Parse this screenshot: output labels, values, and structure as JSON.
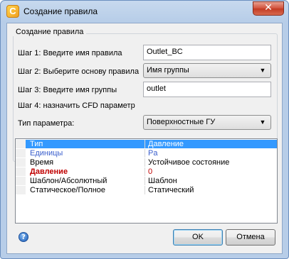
{
  "window": {
    "title": "Создание правила",
    "close_glyph": "✕",
    "app_icon": "C"
  },
  "group": {
    "title": "Создание правила"
  },
  "step1": {
    "label": "Шаг 1: Введите имя правила",
    "value": "Outlet_BC"
  },
  "step2": {
    "label": "Шаг 2: Выберите основу правила",
    "value": "Имя группы"
  },
  "step3": {
    "label": "Шаг 3: Введите имя группы",
    "value": "outlet"
  },
  "step4": {
    "label": "Шаг 4: назначить CFD параметр"
  },
  "param_type": {
    "label": "Тип параметра:",
    "value": "Поверхностные ГУ"
  },
  "grid": {
    "rows": [
      {
        "name": "Тип",
        "value": "Давление",
        "selected": true
      },
      {
        "name": "Единицы",
        "value": "Pa",
        "color": "#3a5fcd"
      },
      {
        "name": "Время",
        "value": "Устойчивое состояние"
      },
      {
        "name": "Давление",
        "value": "0",
        "color": "#c00000",
        "bold": true
      },
      {
        "name": "Шаблон/Абсолютный",
        "value": "Шаблон"
      },
      {
        "name": "Статическое/Полное",
        "value": "Статический"
      }
    ]
  },
  "buttons": {
    "ok": "OK",
    "cancel": "Отмена",
    "help": "?"
  },
  "colors": {
    "selection": "#3399ff",
    "units_text": "#3a5fcd",
    "pressure_text": "#c00000"
  }
}
